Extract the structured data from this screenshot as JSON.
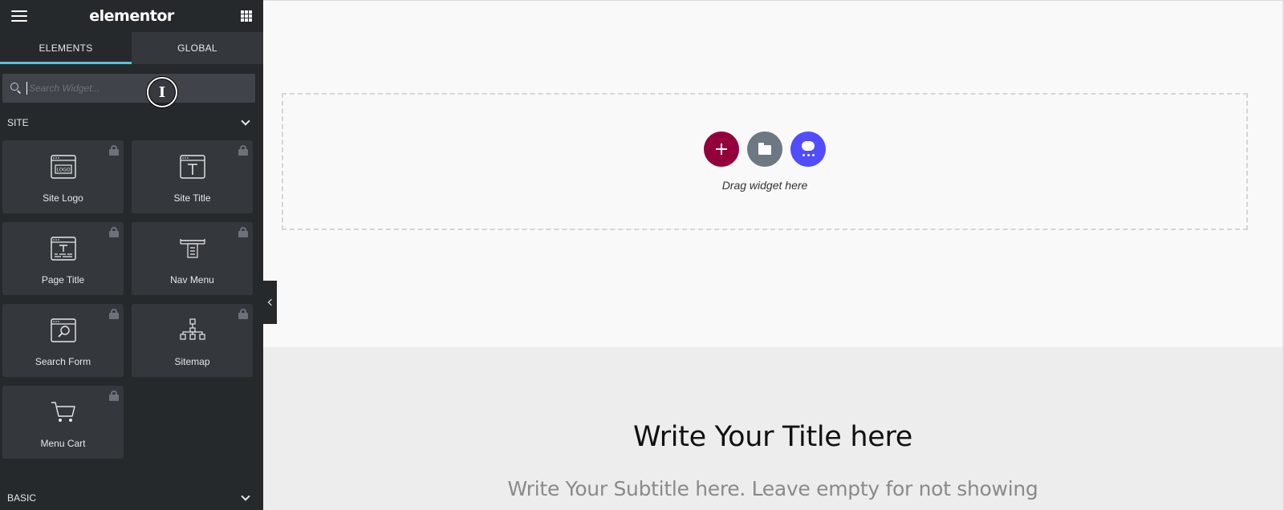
{
  "app": {
    "logo_text": "elementor"
  },
  "tabs": [
    {
      "label": "ELEMENTS",
      "active": true
    },
    {
      "label": "GLOBAL",
      "active": false
    }
  ],
  "search": {
    "placeholder": "Search Widget...",
    "value": ""
  },
  "sections": {
    "site": {
      "title": "SITE",
      "widgets": [
        {
          "label": "Site Logo",
          "icon": "site-logo-icon",
          "locked": true
        },
        {
          "label": "Site Title",
          "icon": "site-title-icon",
          "locked": true
        },
        {
          "label": "Page Title",
          "icon": "page-title-icon",
          "locked": true
        },
        {
          "label": "Nav Menu",
          "icon": "nav-menu-icon",
          "locked": true
        },
        {
          "label": "Search Form",
          "icon": "search-form-icon",
          "locked": true
        },
        {
          "label": "Sitemap",
          "icon": "sitemap-icon",
          "locked": true
        },
        {
          "label": "Menu Cart",
          "icon": "menu-cart-icon",
          "locked": true
        }
      ]
    },
    "basic": {
      "title": "BASIC"
    }
  },
  "canvas": {
    "drop_text": "Drag widget here",
    "hero_title": "Write Your Title here",
    "hero_subtitle": "Write Your Subtitle here. Leave empty for not showing"
  },
  "colors": {
    "panel_bg": "#26292c",
    "tab_accent": "#5bc0de",
    "add_button": "#93003c",
    "template_button": "#6d7882",
    "kit_button": "#524cff"
  }
}
